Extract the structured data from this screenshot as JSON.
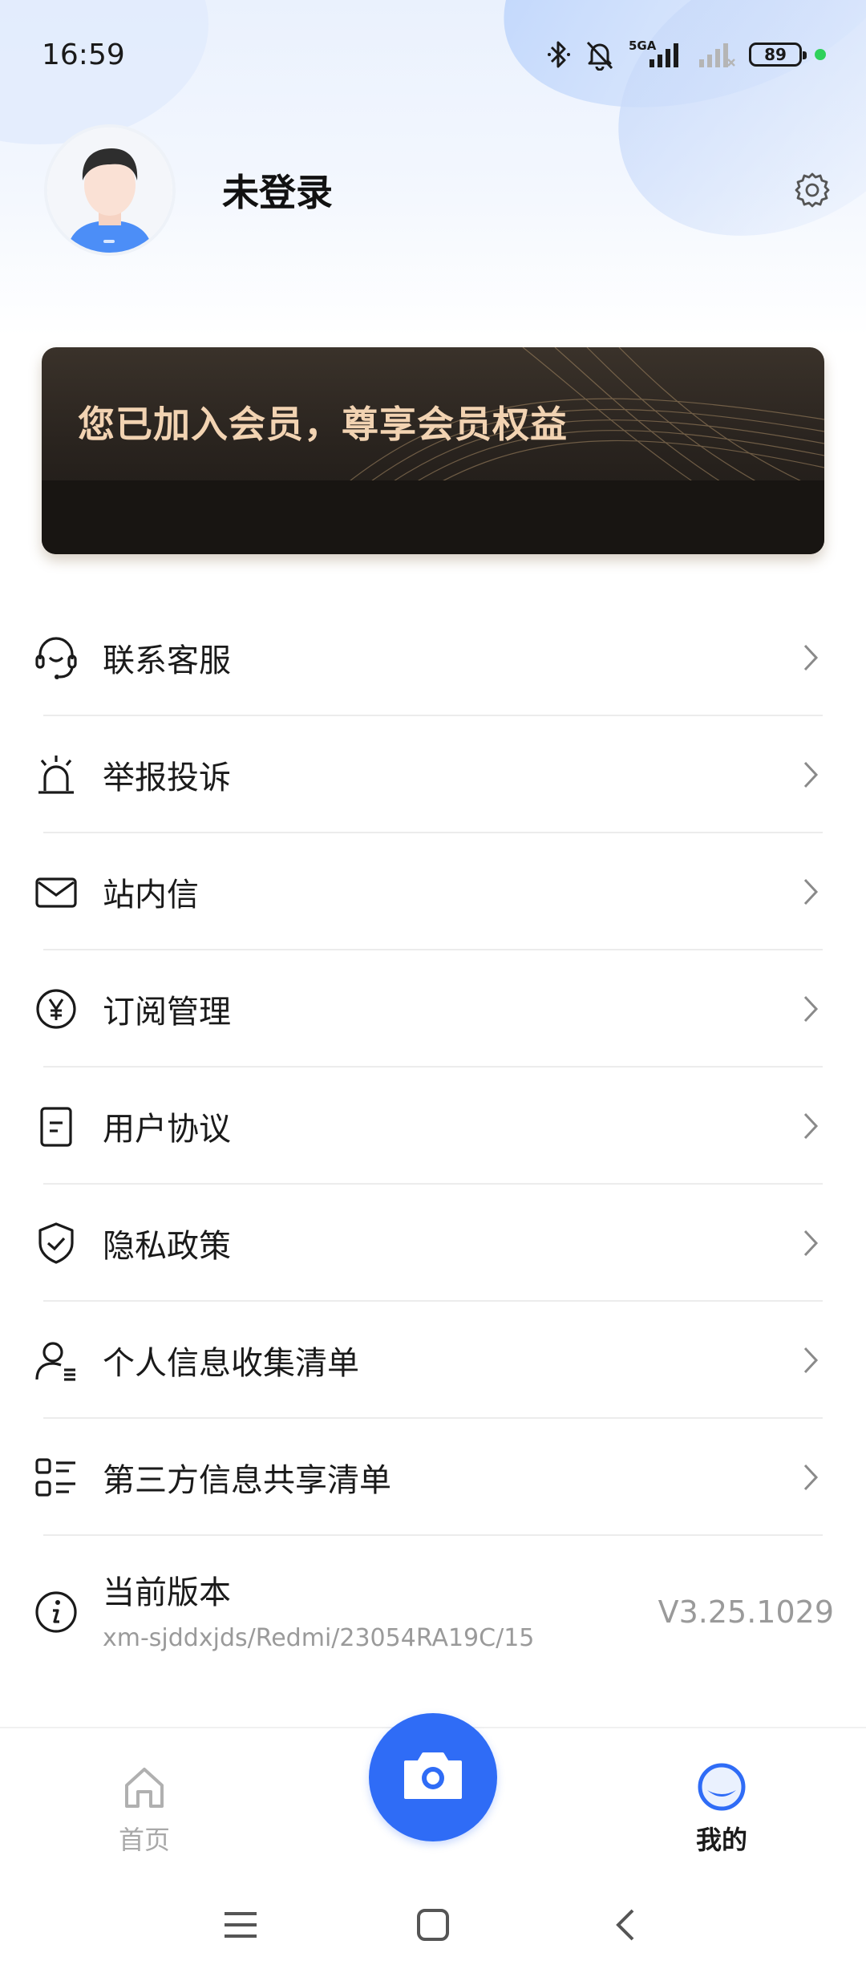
{
  "status_bar": {
    "time": "16:59",
    "network": "5GA",
    "battery": "89",
    "icons": [
      "bluetooth-icon",
      "mute-icon",
      "signal-icon",
      "signal-icon",
      "battery-icon",
      "dot-icon"
    ]
  },
  "profile": {
    "name": "未登录",
    "settings_icon": "gear-icon"
  },
  "vip_banner": {
    "text": "您已加入会员，尊享会员权益"
  },
  "menu": {
    "items": [
      {
        "label": "联系客服",
        "icon": "headset-icon"
      },
      {
        "label": "举报投诉",
        "icon": "alarm-icon"
      },
      {
        "label": "站内信",
        "icon": "mail-icon"
      },
      {
        "label": "订阅管理",
        "icon": "yen-icon"
      },
      {
        "label": "用户协议",
        "icon": "document-icon"
      },
      {
        "label": "隐私政策",
        "icon": "shield-check-icon"
      },
      {
        "label": "个人信息收集清单",
        "icon": "user-list-icon"
      },
      {
        "label": "第三方信息共享清单",
        "icon": "grid-list-icon"
      }
    ],
    "version": {
      "label": "当前版本",
      "sub": "xm-sjddxjds/Redmi/23054RA19C/15",
      "value": "V3.25.1029"
    }
  },
  "bottom_nav": {
    "home_label": "首页",
    "mine_label": "我的",
    "accent": "#2f6cf6"
  }
}
